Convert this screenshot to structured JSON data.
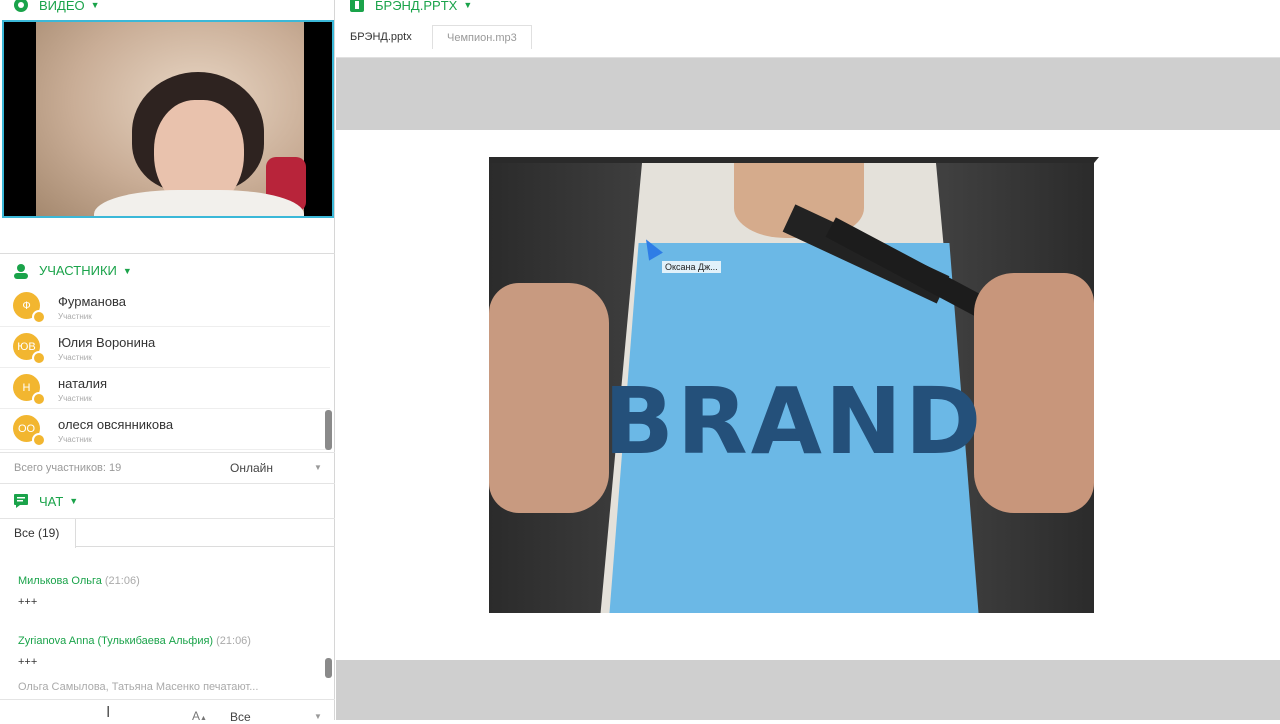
{
  "video": {
    "title": "ВИДЕО"
  },
  "participants": {
    "title": "УЧАСТНИКИ",
    "items": [
      {
        "initials": "Ф",
        "name": "Фурманова",
        "role": "Участник"
      },
      {
        "initials": "ЮВ",
        "name": "Юлия Воронина",
        "role": "Участник"
      },
      {
        "initials": "Н",
        "name": "наталия",
        "role": "Участник"
      },
      {
        "initials": "ОО",
        "name": "олеся овсянникова",
        "role": "Участник"
      }
    ],
    "total": "Всего участников: 19",
    "status_filter": "Онлайн"
  },
  "chat": {
    "title": "ЧАТ",
    "tab_all": "Все (19)",
    "messages": [
      {
        "author": "Милькова Ольга",
        "time": "(21:06)",
        "text": "+++"
      },
      {
        "author": "Zyrianova Anna (Тулькибаева Альфия)",
        "time": "(21:06)",
        "text": "+++"
      }
    ],
    "typing": "Ольга Самылова, Татьяна Масенко печатают...",
    "font_button": "A",
    "recipient": "Все"
  },
  "document": {
    "title": "БРЭНД.PPTX",
    "tabs": [
      "БРЭНД.pptx",
      "Чемпион.mp3"
    ],
    "slide_text": "BRAND",
    "cursor_label": "Оксана Дж..."
  },
  "colors": {
    "accent": "#1aa34a",
    "avatar": "#f2b630",
    "video_border": "#3bb8d8"
  }
}
